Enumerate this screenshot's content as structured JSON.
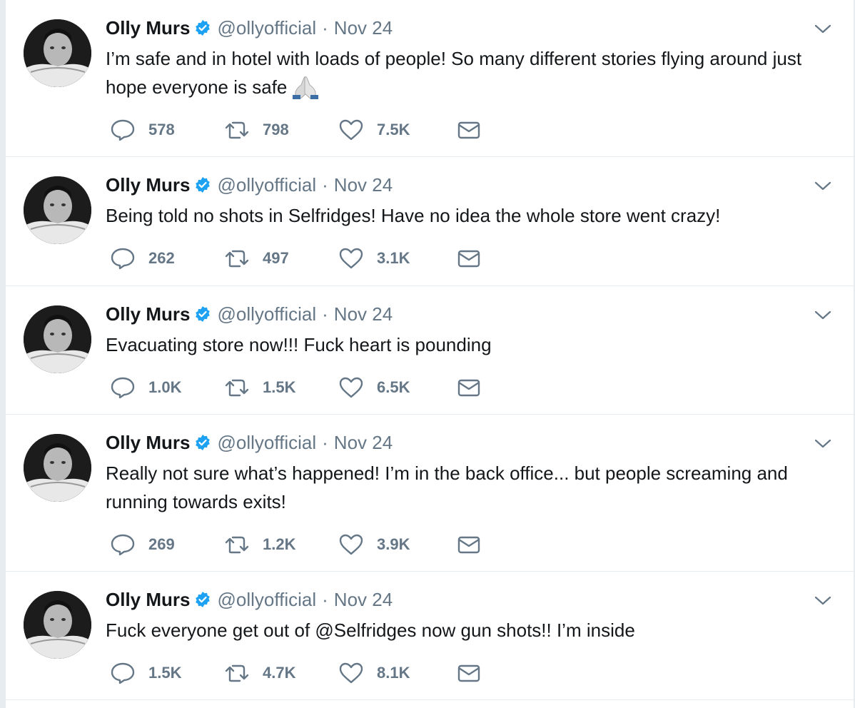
{
  "colors": {
    "text": "#14171a",
    "secondary": "#657786",
    "verified": "#1da1f2",
    "divider": "#e6ecf0"
  },
  "tweets": [
    {
      "name": "Olly Murs",
      "handle": "@ollyofficial",
      "separator": "·",
      "date": "Nov 24",
      "text": "I’m safe and in hotel with loads of people! So many different stories flying around just hope everyone is safe",
      "emoji": "folded-hands-emoji",
      "replies": "578",
      "retweets": "798",
      "likes": "7.5K"
    },
    {
      "name": "Olly Murs",
      "handle": "@ollyofficial",
      "separator": "·",
      "date": "Nov 24",
      "text": "Being told no shots in Selfridges! Have no idea the whole store went crazy!",
      "replies": "262",
      "retweets": "497",
      "likes": "3.1K"
    },
    {
      "name": "Olly Murs",
      "handle": "@ollyofficial",
      "separator": "·",
      "date": "Nov 24",
      "text": "Evacuating store now!!! Fuck heart is pounding",
      "replies": "1.0K",
      "retweets": "1.5K",
      "likes": "6.5K"
    },
    {
      "name": "Olly Murs",
      "handle": "@ollyofficial",
      "separator": "·",
      "date": "Nov 24",
      "text": "Really not sure what’s happened! I’m in the back office... but people screaming and running towards exits!",
      "replies": "269",
      "retweets": "1.2K",
      "likes": "3.9K"
    },
    {
      "name": "Olly Murs",
      "handle": "@ollyofficial",
      "separator": "·",
      "date": "Nov 24",
      "text": "Fuck everyone get out of @Selfridges now gun shots!! I’m inside",
      "replies": "1.5K",
      "retweets": "4.7K",
      "likes": "8.1K"
    }
  ]
}
